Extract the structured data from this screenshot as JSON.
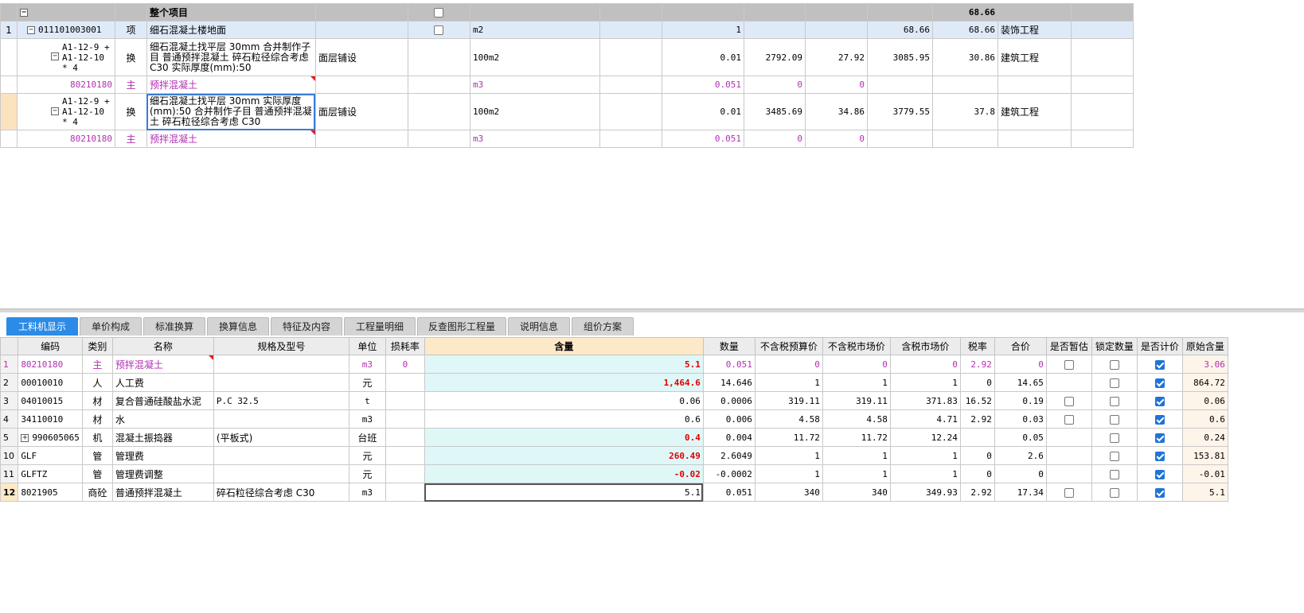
{
  "top": {
    "total_row": {
      "name": "整个项目",
      "sum": "68.66"
    },
    "rows": [
      {
        "num": "1",
        "code": "011101003001",
        "type": "项",
        "name": "细石混凝土楼地面",
        "feature": "",
        "unit": "m2",
        "qty": "1",
        "a": "",
        "b": "",
        "c": "68.66",
        "d": "68.66",
        "major": "装饰工程"
      },
      {
        "num": "",
        "code": "A1-12-9 + A1-12-10 * 4",
        "type": "换",
        "name": "细石混凝土找平层 30mm  合并制作子目 普通预拌混凝土 碎石粒径综合考虑 C30  实际厚度(mm):50",
        "feature": "面层铺设",
        "unit": "100m2",
        "qty": "0.01",
        "a": "2792.09",
        "b": "27.92",
        "c": "3085.95",
        "d": "30.86",
        "major": "建筑工程"
      },
      {
        "num": "",
        "code": "80210180",
        "type": "主",
        "name": "预拌混凝土",
        "feature": "",
        "unit": "m3",
        "qty": "0.051",
        "a": "0",
        "b": "0",
        "c": "",
        "d": "",
        "major": ""
      },
      {
        "num": "",
        "code": "A1-12-9 + A1-12-10 * 4",
        "type": "换",
        "name": "细石混凝土找平层 30mm  实际厚度(mm):50  合并制作子目 普通预拌混凝土 碎石粒径综合考虑 C30",
        "feature": "面层铺设",
        "unit": "100m2",
        "qty": "0.01",
        "a": "3485.69",
        "b": "34.86",
        "c": "3779.55",
        "d": "37.8",
        "major": "建筑工程"
      },
      {
        "num": "",
        "code": "80210180",
        "type": "主",
        "name": "预拌混凝土",
        "feature": "",
        "unit": "m3",
        "qty": "0.051",
        "a": "0",
        "b": "0",
        "c": "",
        "d": "",
        "major": ""
      }
    ]
  },
  "tabs": [
    "工料机显示",
    "单价构成",
    "标准换算",
    "换算信息",
    "特征及内容",
    "工程量明细",
    "反查图形工程量",
    "说明信息",
    "组价方案"
  ],
  "bottom": {
    "headers": [
      "编码",
      "类别",
      "名称",
      "规格及型号",
      "单位",
      "损耗率",
      "含量",
      "数量",
      "不含税预算价",
      "不含税市场价",
      "含税市场价",
      "税率",
      "合价",
      "是否暂估",
      "锁定数量",
      "是否计价",
      "原始含量"
    ],
    "rows": [
      {
        "num": "1",
        "code": "80210180",
        "cat": "主",
        "name": "预拌混凝土",
        "spec": "",
        "unit": "m3",
        "loss": "0",
        "content": "5.1",
        "qty": "0.051",
        "p1": "0",
        "p2": "0",
        "p3": "0",
        "tax": "2.92",
        "total": "0",
        "orig": "3.06"
      },
      {
        "num": "2",
        "code": "00010010",
        "cat": "人",
        "name": "人工费",
        "spec": "",
        "unit": "元",
        "loss": "",
        "content": "1,464.6",
        "qty": "14.646",
        "p1": "1",
        "p2": "1",
        "p3": "1",
        "tax": "0",
        "total": "14.65",
        "orig": "864.72"
      },
      {
        "num": "3",
        "code": "04010015",
        "cat": "材",
        "name": "复合普通硅酸盐水泥",
        "spec": "P.C 32.5",
        "unit": "t",
        "loss": "",
        "content": "0.06",
        "qty": "0.0006",
        "p1": "319.11",
        "p2": "319.11",
        "p3": "371.83",
        "tax": "16.52",
        "total": "0.19",
        "orig": "0.06"
      },
      {
        "num": "4",
        "code": "34110010",
        "cat": "材",
        "name": "水",
        "spec": "",
        "unit": "m3",
        "loss": "",
        "content": "0.6",
        "qty": "0.006",
        "p1": "4.58",
        "p2": "4.58",
        "p3": "4.71",
        "tax": "2.92",
        "total": "0.03",
        "orig": "0.6"
      },
      {
        "num": "5",
        "code": "990605065",
        "cat": "机",
        "name": "混凝土振捣器",
        "spec": "(平板式)",
        "unit": "台班",
        "loss": "",
        "content": "0.4",
        "qty": "0.004",
        "p1": "11.72",
        "p2": "11.72",
        "p3": "12.24",
        "tax": "",
        "total": "0.05",
        "orig": "0.24"
      },
      {
        "num": "10",
        "code": "GLF",
        "cat": "管",
        "name": "管理费",
        "spec": "",
        "unit": "元",
        "loss": "",
        "content": "260.49",
        "qty": "2.6049",
        "p1": "1",
        "p2": "1",
        "p3": "1",
        "tax": "0",
        "total": "2.6",
        "orig": "153.81"
      },
      {
        "num": "11",
        "code": "GLFTZ",
        "cat": "管",
        "name": "管理费调整",
        "spec": "",
        "unit": "元",
        "loss": "",
        "content": "-0.02",
        "qty": "-0.0002",
        "p1": "1",
        "p2": "1",
        "p3": "1",
        "tax": "0",
        "total": "0",
        "orig": "-0.01"
      },
      {
        "num": "12",
        "code": "8021905",
        "cat": "商砼",
        "name": "普通预拌混凝土",
        "spec": "碎石粒径综合考虑 C30",
        "unit": "m3",
        "loss": "",
        "content": "5.1",
        "qty": "0.051",
        "p1": "340",
        "p2": "340",
        "p3": "349.93",
        "tax": "2.92",
        "total": "17.34",
        "orig": "5.1"
      }
    ]
  }
}
